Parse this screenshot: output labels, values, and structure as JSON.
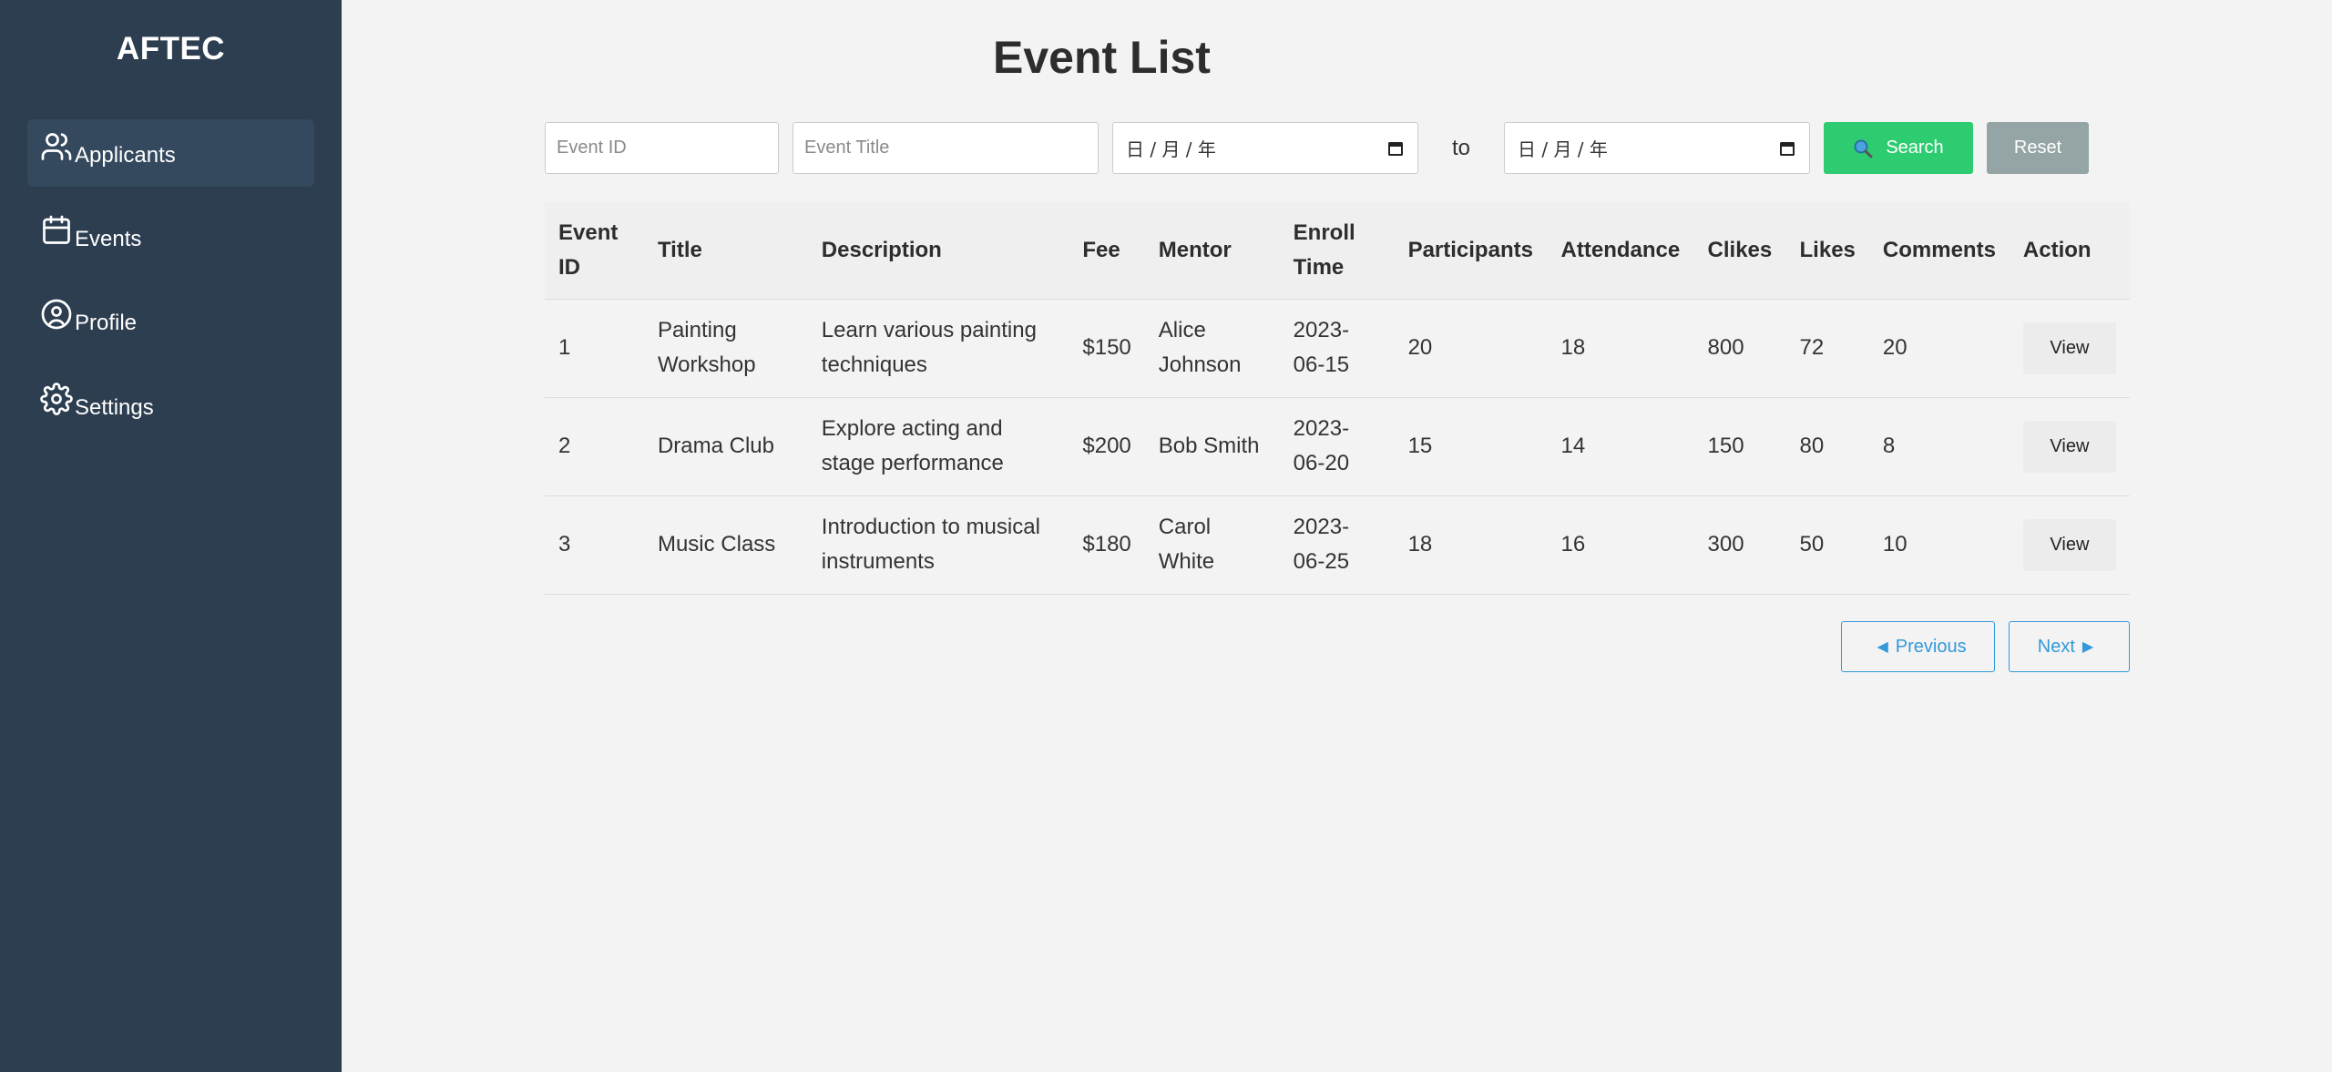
{
  "sidebar": {
    "brand": "AFTEC",
    "items": [
      {
        "label": "Applicants",
        "icon": "users-icon",
        "active": true
      },
      {
        "label": "Events",
        "icon": "calendar-icon"
      },
      {
        "label": "Profile",
        "icon": "user-circle-icon"
      },
      {
        "label": "Settings",
        "icon": "gear-icon"
      }
    ]
  },
  "page": {
    "title": "Event List"
  },
  "filters": {
    "event_id_placeholder": "Event ID",
    "event_title_placeholder": "Event Title",
    "date_from_placeholder": "日 / 月 /  年",
    "to_label": "to",
    "date_to_placeholder": "日 / 月 /  年",
    "search_label": "Search",
    "reset_label": "Reset"
  },
  "table": {
    "headers": [
      "Event ID",
      "Title",
      "Description",
      "Fee",
      "Mentor",
      "Enroll Time",
      "Participants",
      "Attendance",
      "Clikes",
      "Likes",
      "Comments",
      "Action"
    ],
    "rows": [
      {
        "id": "1",
        "title": "Painting Workshop",
        "description": "Learn various painting techniques",
        "fee": "$150",
        "mentor": "Alice Johnson",
        "enroll_time": "2023-06-15",
        "participants": "20",
        "attendance": "18",
        "clikes": "800",
        "likes": "72",
        "comments": "20",
        "action": "View"
      },
      {
        "id": "2",
        "title": "Drama Club",
        "description": "Explore acting and stage performance",
        "fee": "$200",
        "mentor": "Bob Smith",
        "enroll_time": "2023-06-20",
        "participants": "15",
        "attendance": "14",
        "clikes": "150",
        "likes": "80",
        "comments": "8",
        "action": "View"
      },
      {
        "id": "3",
        "title": "Music Class",
        "description": "Introduction to musical instruments",
        "fee": "$180",
        "mentor": "Carol White",
        "enroll_time": "2023-06-25",
        "participants": "18",
        "attendance": "16",
        "clikes": "300",
        "likes": "50",
        "comments": "10",
        "action": "View"
      }
    ]
  },
  "pagination": {
    "previous_label": "Previous",
    "next_label": "Next"
  },
  "colors": {
    "sidebar_bg": "#2c3e50",
    "search_btn": "#2ecc71",
    "reset_btn": "#95a5a6",
    "link_blue": "#3498db"
  }
}
